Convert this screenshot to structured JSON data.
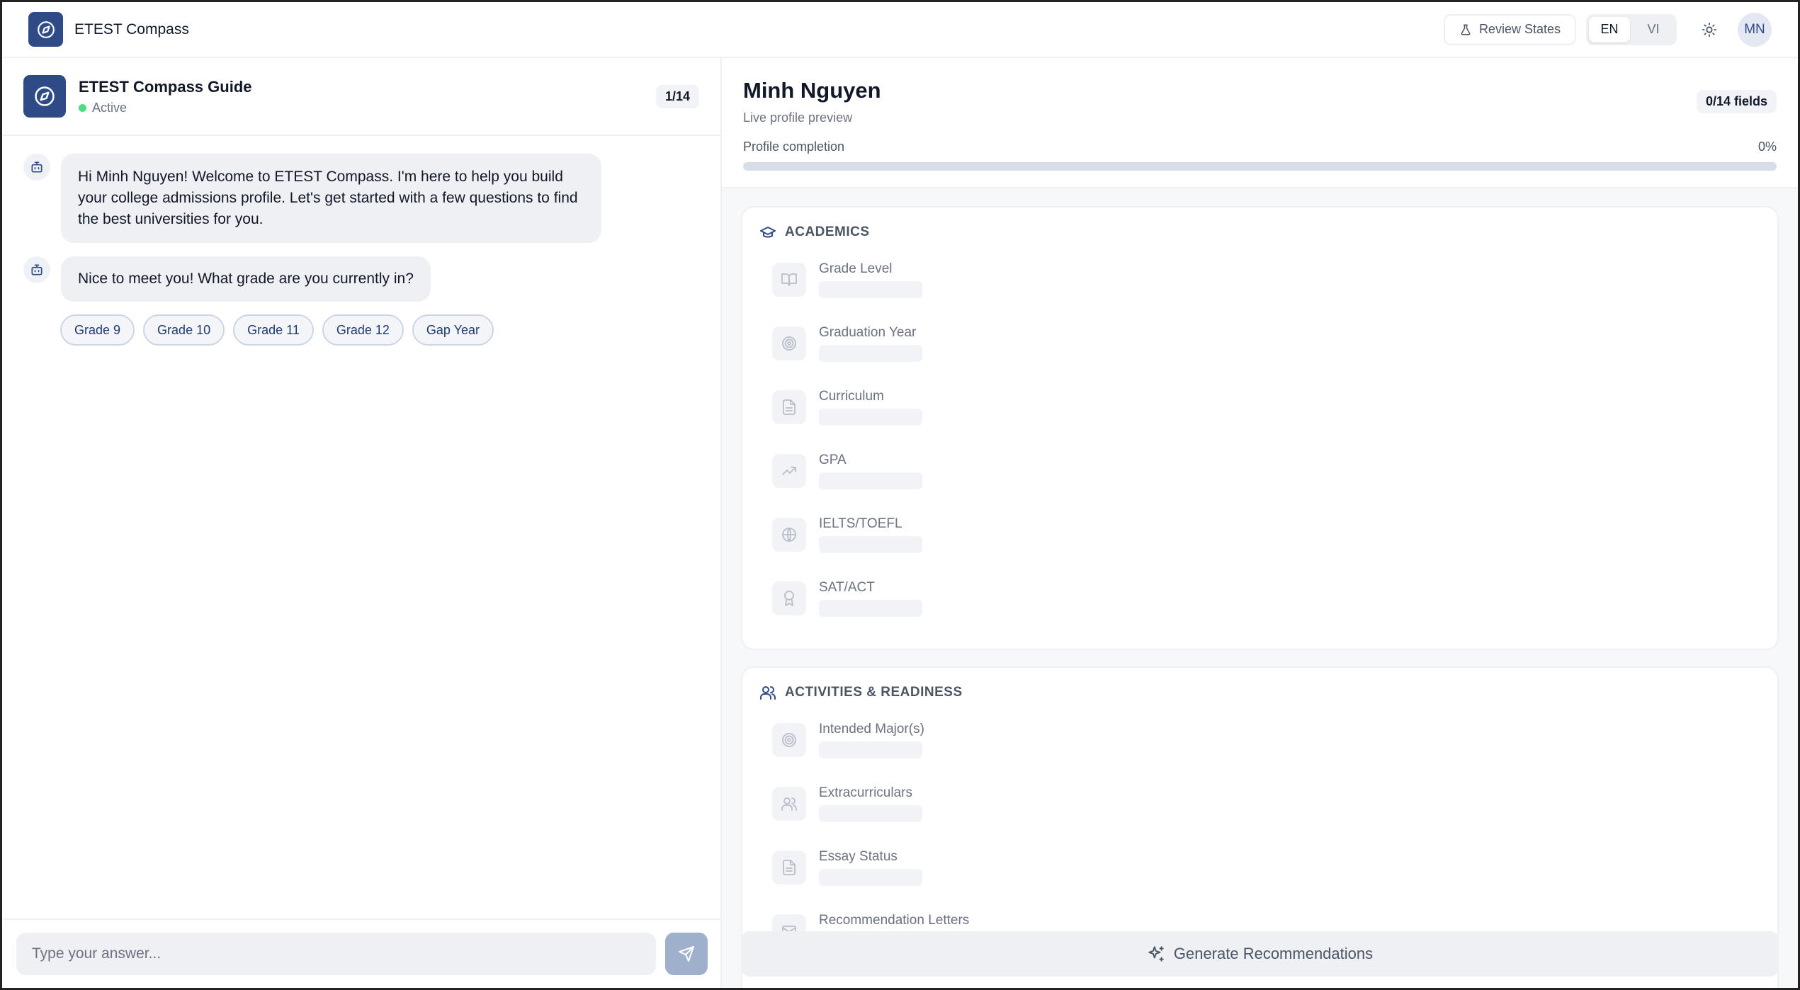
{
  "app": {
    "title": "ETEST Compass",
    "review_label": "Review States",
    "languages": [
      "EN",
      "VI"
    ],
    "active_language": "EN",
    "avatar_initials": "MN"
  },
  "chat": {
    "guide_name": "ETEST Compass Guide",
    "status": "Active",
    "step": "1/14",
    "messages": [
      "Hi Minh Nguyen! Welcome to ETEST Compass. I'm here to help you build your college admissions profile. Let's get started with a few questions to find the best universities for you.",
      "Nice to meet you! What grade are you currently in?"
    ],
    "options": [
      "Grade 9",
      "Grade 10",
      "Grade 11",
      "Grade 12",
      "Gap Year"
    ],
    "input_placeholder": "Type your answer..."
  },
  "profile": {
    "name": "Minh Nguyen",
    "subtitle": "Live profile preview",
    "fields_count": "0/14 fields",
    "completion_label": "Profile completion",
    "completion_percent": "0%",
    "completion_value": 0,
    "sections": {
      "academics": {
        "title": "ACADEMICS",
        "fields": [
          "Grade Level",
          "Graduation Year",
          "Curriculum",
          "GPA",
          "IELTS/TOEFL",
          "SAT/ACT"
        ]
      },
      "activities": {
        "title": "ACTIVITIES & READINESS",
        "fields": [
          "Intended Major(s)",
          "Extracurriculars",
          "Essay Status",
          "Recommendation Letters"
        ]
      }
    },
    "generate_label": "Generate Recommendations"
  },
  "icons": {
    "logo": "compass-icon",
    "review": "flask-icon",
    "theme": "sun-icon",
    "bot": "bot-icon",
    "send": "send-icon",
    "academics": "graduation-cap-icon",
    "activities": "users-icon",
    "generate": "sparkles-icon"
  },
  "colors": {
    "brand": "#2f4b87",
    "status_active": "#4ade80"
  }
}
